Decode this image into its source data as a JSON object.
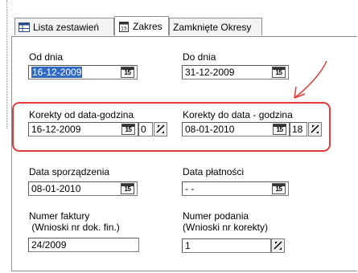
{
  "tabs": [
    {
      "label": "Lista zestawień",
      "icon": "grid-list-icon",
      "active": false
    },
    {
      "label": "Zakres",
      "icon": "calendar-page-icon",
      "active": true
    },
    {
      "label": "Zamknięte Okresy",
      "active": false
    }
  ],
  "form": {
    "od_dnia": {
      "label": "Od dnia",
      "value": "16-12-2009"
    },
    "do_dnia": {
      "label": "Do dnia",
      "value": "31-12-2009"
    },
    "korekty_od": {
      "label": "Korekty od data-godzina",
      "date": "16-12-2009",
      "hour": "0"
    },
    "korekty_do": {
      "label": "Korekty do data - godzina",
      "date": "08-01-2010",
      "hour": "18"
    },
    "data_sporzadzenia": {
      "label": "Data sporządzenia",
      "value": "08-01-2010"
    },
    "data_platnosci": {
      "label": "Data płatności",
      "value": " - -"
    },
    "numer_faktury": {
      "label_line1": "Numer faktury",
      "label_line2": " (Wnioski nr dok. fin.)",
      "value": "24/2009"
    },
    "numer_podania": {
      "label_line1": "Numer podania",
      "label_line2": "(Wnioski nr korekty)",
      "value": "1"
    }
  },
  "icons": {
    "calendar": "calendar-icon",
    "spinner": "spinner-icon"
  },
  "calendar_glyph": "15",
  "colors": {
    "highlight": "#e23a3a",
    "arrow": "#e23a3a",
    "selection": "#316ac5"
  }
}
